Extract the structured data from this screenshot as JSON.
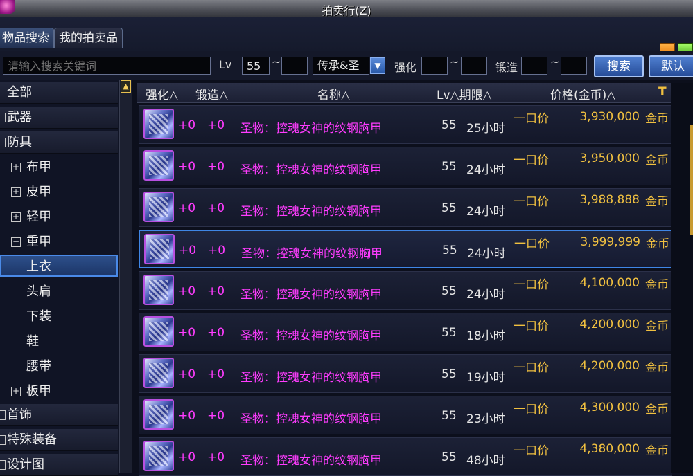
{
  "window": {
    "title": "拍卖行(Z)"
  },
  "tabs": [
    {
      "label": "物品搜索",
      "active": true
    },
    {
      "label": "我的拍卖品",
      "active": false
    }
  ],
  "search": {
    "keyword_placeholder": "请输入搜索关键词",
    "lv_label": "Lv",
    "lv_min": "55",
    "lv_max": "",
    "tilde": "~",
    "type_select": "传承&圣",
    "qianghua_label": "强化",
    "qianghua_min": "",
    "qianghua_max": "",
    "duanzao_label": "锻造",
    "duanzao_min": "",
    "duanzao_max": "",
    "search_button": "搜索",
    "default_button": "默认"
  },
  "sidebar": {
    "categories": [
      {
        "label": "全部",
        "level": 0,
        "expander": "",
        "selected": false
      },
      {
        "label": "武器",
        "level": 0,
        "expander": "",
        "selected": false
      },
      {
        "label": "防具",
        "level": 0,
        "expander": "",
        "selected": false
      },
      {
        "label": "布甲",
        "level": 1,
        "expander": "+",
        "selected": false
      },
      {
        "label": "皮甲",
        "level": 1,
        "expander": "+",
        "selected": false
      },
      {
        "label": "轻甲",
        "level": 1,
        "expander": "+",
        "selected": false
      },
      {
        "label": "重甲",
        "level": 1,
        "expander": "−",
        "selected": false
      },
      {
        "label": "上衣",
        "level": 2,
        "expander": "",
        "selected": true
      },
      {
        "label": "头肩",
        "level": 2,
        "expander": "",
        "selected": false
      },
      {
        "label": "下装",
        "level": 2,
        "expander": "",
        "selected": false
      },
      {
        "label": "鞋",
        "level": 2,
        "expander": "",
        "selected": false
      },
      {
        "label": "腰带",
        "level": 2,
        "expander": "",
        "selected": false
      },
      {
        "label": "板甲",
        "level": 1,
        "expander": "+",
        "selected": false
      },
      {
        "label": "首饰",
        "level": 0,
        "expander": "",
        "selected": false
      },
      {
        "label": "特殊装备",
        "level": 0,
        "expander": "",
        "selected": false
      },
      {
        "label": "设计图",
        "level": 0,
        "expander": "",
        "selected": false
      }
    ]
  },
  "table": {
    "headers": {
      "qianghua": "强化△",
      "duanzao": "锻造△",
      "name": "名称△",
      "lv_qixian": "Lv△期限△",
      "price": "价格(金币)△"
    },
    "rows": [
      {
        "qianghua": "+0",
        "duanzao": "+0",
        "name": "圣物：控魂女神的纹钢胸甲",
        "lv": "55",
        "time": "25小时",
        "buyout": "一口价",
        "price": "3,930,000",
        "currency": "金币",
        "selected": false
      },
      {
        "qianghua": "+0",
        "duanzao": "+0",
        "name": "圣物：控魂女神的纹钢胸甲",
        "lv": "55",
        "time": "24小时",
        "buyout": "一口价",
        "price": "3,950,000",
        "currency": "金币",
        "selected": false
      },
      {
        "qianghua": "+0",
        "duanzao": "+0",
        "name": "圣物：控魂女神的纹钢胸甲",
        "lv": "55",
        "time": "24小时",
        "buyout": "一口价",
        "price": "3,988,888",
        "currency": "金币",
        "selected": false
      },
      {
        "qianghua": "+0",
        "duanzao": "+0",
        "name": "圣物：控魂女神的纹钢胸甲",
        "lv": "55",
        "time": "24小时",
        "buyout": "一口价",
        "price": "3,999,999",
        "currency": "金币",
        "selected": true
      },
      {
        "qianghua": "+0",
        "duanzao": "+0",
        "name": "圣物：控魂女神的纹钢胸甲",
        "lv": "55",
        "time": "24小时",
        "buyout": "一口价",
        "price": "4,100,000",
        "currency": "金币",
        "selected": false
      },
      {
        "qianghua": "+0",
        "duanzao": "+0",
        "name": "圣物：控魂女神的纹钢胸甲",
        "lv": "55",
        "time": "18小时",
        "buyout": "一口价",
        "price": "4,200,000",
        "currency": "金币",
        "selected": false
      },
      {
        "qianghua": "+0",
        "duanzao": "+0",
        "name": "圣物：控魂女神的纹钢胸甲",
        "lv": "55",
        "time": "19小时",
        "buyout": "一口价",
        "price": "4,200,000",
        "currency": "金币",
        "selected": false
      },
      {
        "qianghua": "+0",
        "duanzao": "+0",
        "name": "圣物：控魂女神的纹钢胸甲",
        "lv": "55",
        "time": "23小时",
        "buyout": "一口价",
        "price": "4,300,000",
        "currency": "金币",
        "selected": false
      },
      {
        "qianghua": "+0",
        "duanzao": "+0",
        "name": "圣物：控魂女神的纹钢胸甲",
        "lv": "55",
        "time": "48小时",
        "buyout": "一口价",
        "price": "4,380,000",
        "currency": "金币",
        "selected": false
      }
    ]
  },
  "colors": {
    "item_name": "#ff3cff",
    "enhance": "#ff3cff",
    "price": "#f0c040",
    "selection": "#3f86e6"
  },
  "icons": {
    "window": "emblem-icon",
    "item": "chest-armor-icon",
    "sort": "hammer-icon",
    "scroll_up": "arrow-up-icon",
    "dropdown": "chevron-down-icon"
  }
}
